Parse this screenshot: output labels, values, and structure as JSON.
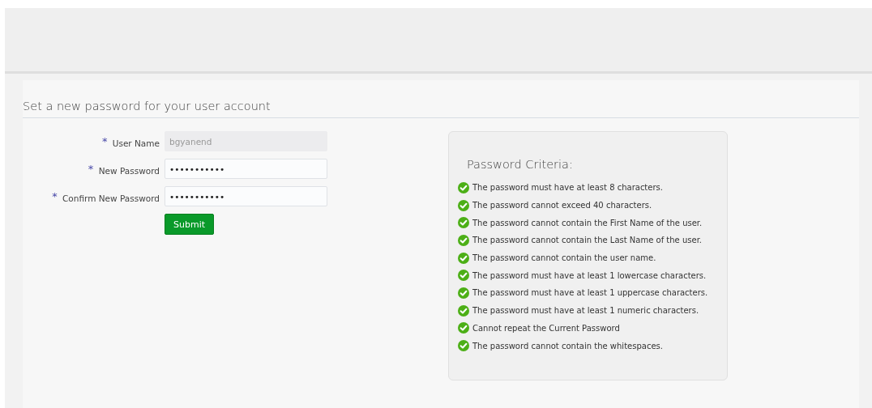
{
  "page_title": "Set a new password for your user account",
  "fields": [
    {
      "label": "User Name",
      "required_mark": "*",
      "disabled": true,
      "value": "bgyanend"
    },
    {
      "label": "New Password",
      "required_mark": "*",
      "disabled": false,
      "value": "•••••••••••"
    },
    {
      "label": "Confirm New Password",
      "required_mark": "*",
      "disabled": false,
      "value": "•••••••••••"
    }
  ],
  "submit": "Submit",
  "criteria": {
    "title": "Password Criteria:",
    "items": [
      {
        "text": "The password must have at least 8 characters.",
        "met": true
      },
      {
        "text": "The password cannot exceed 40 characters.",
        "met": true
      },
      {
        "text": "The password cannot contain the First Name of the user.",
        "met": true
      },
      {
        "text": "The password cannot contain the Last Name of the user.",
        "met": true
      },
      {
        "text": "The password cannot contain the user name.",
        "met": true
      },
      {
        "text": "The password must have at least 1 lowercase characters.",
        "met": true
      },
      {
        "text": "The password must have at least 1 uppercase characters.",
        "met": true
      },
      {
        "text": "The password must have at least 1 numeric characters.",
        "met": true
      },
      {
        "text": "Cannot repeat the Current Password",
        "met": true
      },
      {
        "text": "The password cannot contain the whitespaces.",
        "met": true
      }
    ]
  }
}
